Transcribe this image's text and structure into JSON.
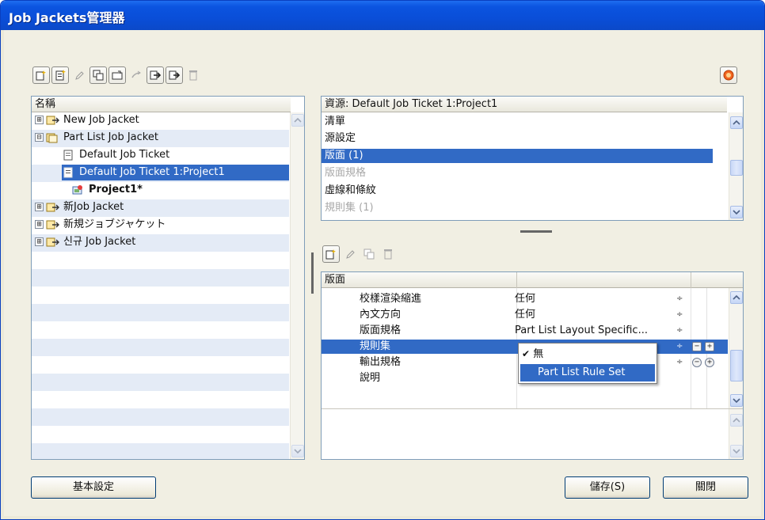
{
  "window": {
    "title": "Job Jackets管理器"
  },
  "toolbar": {
    "icons": [
      "new-jacket-icon",
      "new-ticket-icon",
      "edit-pencil-icon",
      "duplicate-icon",
      "open-folder-icon",
      "link-icon",
      "import-icon",
      "export-icon",
      "delete-icon"
    ],
    "help_icon": "help-icon"
  },
  "tree": {
    "header": "名稱",
    "items": [
      {
        "label": "New Job Jacket",
        "expander": "⊞",
        "icon": "jacket-icon"
      },
      {
        "label": "Part List Job Jacket",
        "expander": "⊟",
        "icon": "jacket-icon"
      },
      {
        "label": "Default Job Ticket",
        "icon": "ticket-icon"
      },
      {
        "label": "Default Job Ticket 1:Project1",
        "icon": "ticket-icon",
        "selected": true
      },
      {
        "label": "Project1*",
        "icon": "project-icon",
        "bold": true
      },
      {
        "label": "新Job Jacket",
        "expander": "⊞",
        "icon": "jacket-icon"
      },
      {
        "label": "新規ジョブジャケット",
        "expander": "⊞",
        "icon": "jacket-icon"
      },
      {
        "label": "신규 Job Jacket",
        "expander": "⊞",
        "icon": "jacket-icon"
      }
    ]
  },
  "resources": {
    "header": "資源: Default Job Ticket 1:Project1",
    "items": [
      {
        "label": "清單"
      },
      {
        "label": "源設定"
      },
      {
        "label": "版面 (1)",
        "selected": true
      },
      {
        "label": "版面規格",
        "dim": true
      },
      {
        "label": "虛線和條紋"
      },
      {
        "label": "規則集 (1)",
        "dim": true
      }
    ]
  },
  "details_toolbar": {
    "icons": [
      "new-item-icon",
      "edit-pencil-icon",
      "duplicate-icon",
      "delete-icon"
    ]
  },
  "details": {
    "header": "版面",
    "rows": [
      {
        "name": "校樣渲染縮進",
        "value": "任何",
        "stepper": "÷"
      },
      {
        "name": "內文方向",
        "value": "任何",
        "stepper": "÷"
      },
      {
        "name": "版面規格",
        "value": "Part List Layout Specific...",
        "stepper": "÷"
      },
      {
        "name": "規則集",
        "value": "",
        "stepper": "÷",
        "selected": true
      },
      {
        "name": "輸出規格",
        "value": "",
        "stepper": "÷"
      },
      {
        "name": "說明",
        "value": ""
      }
    ]
  },
  "dropdown": {
    "items": [
      {
        "label": "無",
        "checked": true
      },
      {
        "label": "Part List Rule Set",
        "highlighted": true
      }
    ]
  },
  "buttons": {
    "preferences": "基本設定",
    "save": "儲存(S)",
    "close": "關閉"
  }
}
